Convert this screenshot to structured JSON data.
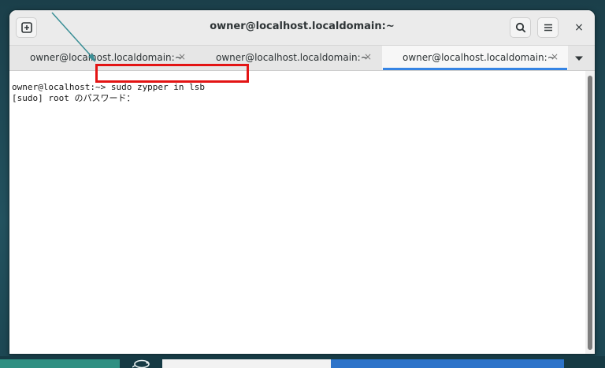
{
  "window": {
    "title": "owner@localhost.localdomain:~",
    "new_tab_icon": "new-tab-icon",
    "search_icon": "search-icon",
    "menu_icon": "hamburger-menu-icon",
    "close_label": "×"
  },
  "tabs": [
    {
      "label": "owner@localhost.localdomain:~",
      "close": "×",
      "active": false
    },
    {
      "label": "owner@localhost.localdomain:~",
      "close": "×",
      "active": false
    },
    {
      "label": "owner@localhost.localdomain:~",
      "close": "×",
      "active": true
    }
  ],
  "terminal": {
    "lines": [
      "owner@localhost:~> sudo zypper in lsb",
      "[sudo] root のパスワード："
    ]
  },
  "colors": {
    "accent": "#3584e4",
    "highlight": "#e31414",
    "arrow": "#3a8f96"
  }
}
